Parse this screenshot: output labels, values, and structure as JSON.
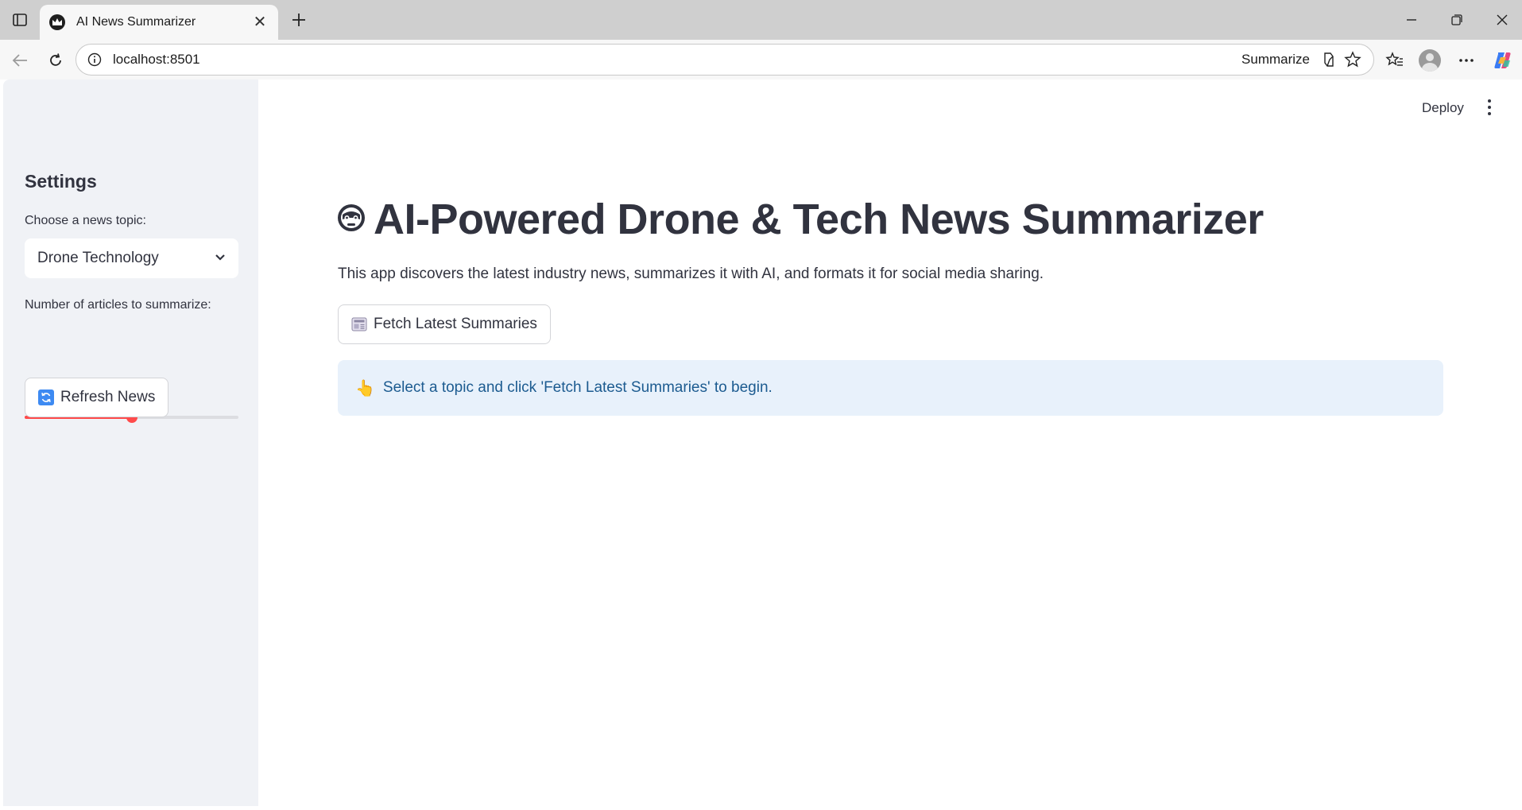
{
  "browser": {
    "tab_title": "AI News Summarizer",
    "address": "localhost:8501",
    "summarize_label": "Summarize"
  },
  "sidebar": {
    "title": "Settings",
    "topic_label": "Choose a news topic:",
    "topic_value": "Drone Technology",
    "count_label": "Number of articles to summarize:",
    "count_value": "3",
    "count_fraction": 0.5,
    "refresh_label": "Refresh News"
  },
  "header": {
    "deploy_label": "Deploy"
  },
  "main": {
    "title": "AI-Powered Drone & Tech News Summarizer",
    "description": "This app discovers the latest industry news, summarizes it with AI, and formats it for social media sharing.",
    "fetch_label": "Fetch Latest Summaries",
    "info_emoji": "👆",
    "info_text": "Select a topic and click 'Fetch Latest Summaries' to begin."
  },
  "colors": {
    "accent": "#ff4b4b",
    "sidebar_bg": "#f0f2f6",
    "info_bg": "#e8f1fb",
    "info_text": "#1c5b90",
    "text": "#31333f"
  },
  "icons": {
    "title_icon": "robot-face-icon",
    "fetch_icon": "newspaper-icon",
    "refresh_icon": "refresh-icon"
  }
}
